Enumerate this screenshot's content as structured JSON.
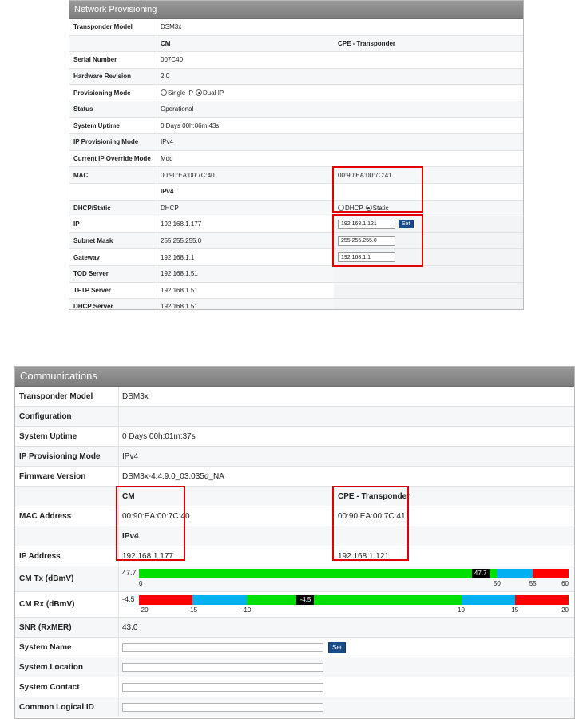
{
  "network": {
    "title": "Network Provisioning",
    "transponder_model": {
      "label": "Transponder Model",
      "value": "DSM3x"
    },
    "columns": {
      "cm": "CM",
      "cpe": "CPE - Transponder"
    },
    "serial_number": {
      "label": "Serial Number",
      "value": "007C40"
    },
    "hardware_revision": {
      "label": "Hardware Revision",
      "value": "2.0"
    },
    "provisioning_mode": {
      "label": "Provisioning Mode",
      "option1": "Single IP",
      "option2": "Dual IP",
      "selected": "Dual IP"
    },
    "status": {
      "label": "Status",
      "value": "Operational"
    },
    "system_uptime": {
      "label": "System Uptime",
      "value": "0 Days 00h:06m:43s"
    },
    "ip_provisioning_mode": {
      "label": "IP Provisioning Mode",
      "value": "IPv4"
    },
    "ip_override_mode": {
      "label": "Current IP Override Mode",
      "value": "Mdd"
    },
    "mac": {
      "label": "MAC",
      "cm": "00:90:EA:00:7C:40",
      "cpe": "00:90:EA:00:7C:41"
    },
    "ipv4_heading": "IPv4",
    "dhcp_static": {
      "label": "DHCP/Static",
      "cm": "DHCP",
      "option1": "DHCP",
      "option2": "Static",
      "selected": "Static"
    },
    "ip": {
      "label": "IP",
      "cm": "192.168.1.177",
      "cpe": "192.168.1.121",
      "set": "Set"
    },
    "subnet_mask": {
      "label": "Subnet Mask",
      "cm": "255.255.255.0",
      "cpe": "255.255.255.0"
    },
    "gateway": {
      "label": "Gateway",
      "cm": "192.168.1.1",
      "cpe": "192.168.1.1"
    },
    "tod_server": {
      "label": "TOD Server",
      "value": "192.168.1.51"
    },
    "tftp_server": {
      "label": "TFTP Server",
      "value": "192.168.1.51"
    },
    "dhcp_server": {
      "label": "DHCP Server",
      "value": "192.168.1.51"
    }
  },
  "communications": {
    "title": "Communications",
    "transponder_model": {
      "label": "Transponder Model",
      "value": "DSM3x"
    },
    "configuration": {
      "label": "Configuration",
      "value": ""
    },
    "system_uptime": {
      "label": "System Uptime",
      "value": "0 Days 00h:01m:37s"
    },
    "ip_provisioning_mode": {
      "label": "IP Provisioning Mode",
      "value": "IPv4"
    },
    "firmware_version": {
      "label": "Firmware Version",
      "value": "DSM3x-4.4.9.0_03.035d_NA"
    },
    "columns": {
      "cm": "CM",
      "cpe": "CPE - Transponder"
    },
    "mac_address": {
      "label": "MAC Address",
      "cm": "00:90:EA:00:7C:40",
      "cpe": "00:90:EA:00:7C:41"
    },
    "ipv4_heading": "IPv4",
    "ip_address": {
      "label": "IP Address",
      "cm": "192.168.1.177",
      "cpe": "192.168.1.121"
    },
    "cm_tx": {
      "label": "CM Tx (dBmV)",
      "value": 47.7,
      "value_text": "47.7",
      "min": 0,
      "max": 60,
      "segments": [
        {
          "from": 0,
          "to": 50,
          "color": "#00e000"
        },
        {
          "from": 50,
          "to": 55,
          "color": "#00b0f0"
        },
        {
          "from": 55,
          "to": 60,
          "color": "#ff0000"
        }
      ],
      "ticks": [
        "0",
        "50",
        "55",
        "60"
      ]
    },
    "cm_rx": {
      "label": "CM Rx (dBmV)",
      "value": -4.5,
      "value_text": "-4.5",
      "min": -20,
      "max": 20,
      "segments": [
        {
          "from": -20,
          "to": -15,
          "color": "#ff0000"
        },
        {
          "from": -15,
          "to": -10,
          "color": "#00b0f0"
        },
        {
          "from": -10,
          "to": 10,
          "color": "#00e000"
        },
        {
          "from": 10,
          "to": 15,
          "color": "#00b0f0"
        },
        {
          "from": 15,
          "to": 20,
          "color": "#ff0000"
        }
      ],
      "ticks": [
        "-20",
        "-15",
        "-10",
        "10",
        "15",
        "20"
      ]
    },
    "snr": {
      "label": "SNR (RxMER)",
      "value": "43.0"
    },
    "system_name": {
      "label": "System Name",
      "value": "",
      "set": "Set"
    },
    "system_location": {
      "label": "System Location",
      "value": ""
    },
    "system_contact": {
      "label": "System Contact",
      "value": ""
    },
    "common_logical_id": {
      "label": "Common Logical ID",
      "value": ""
    }
  }
}
